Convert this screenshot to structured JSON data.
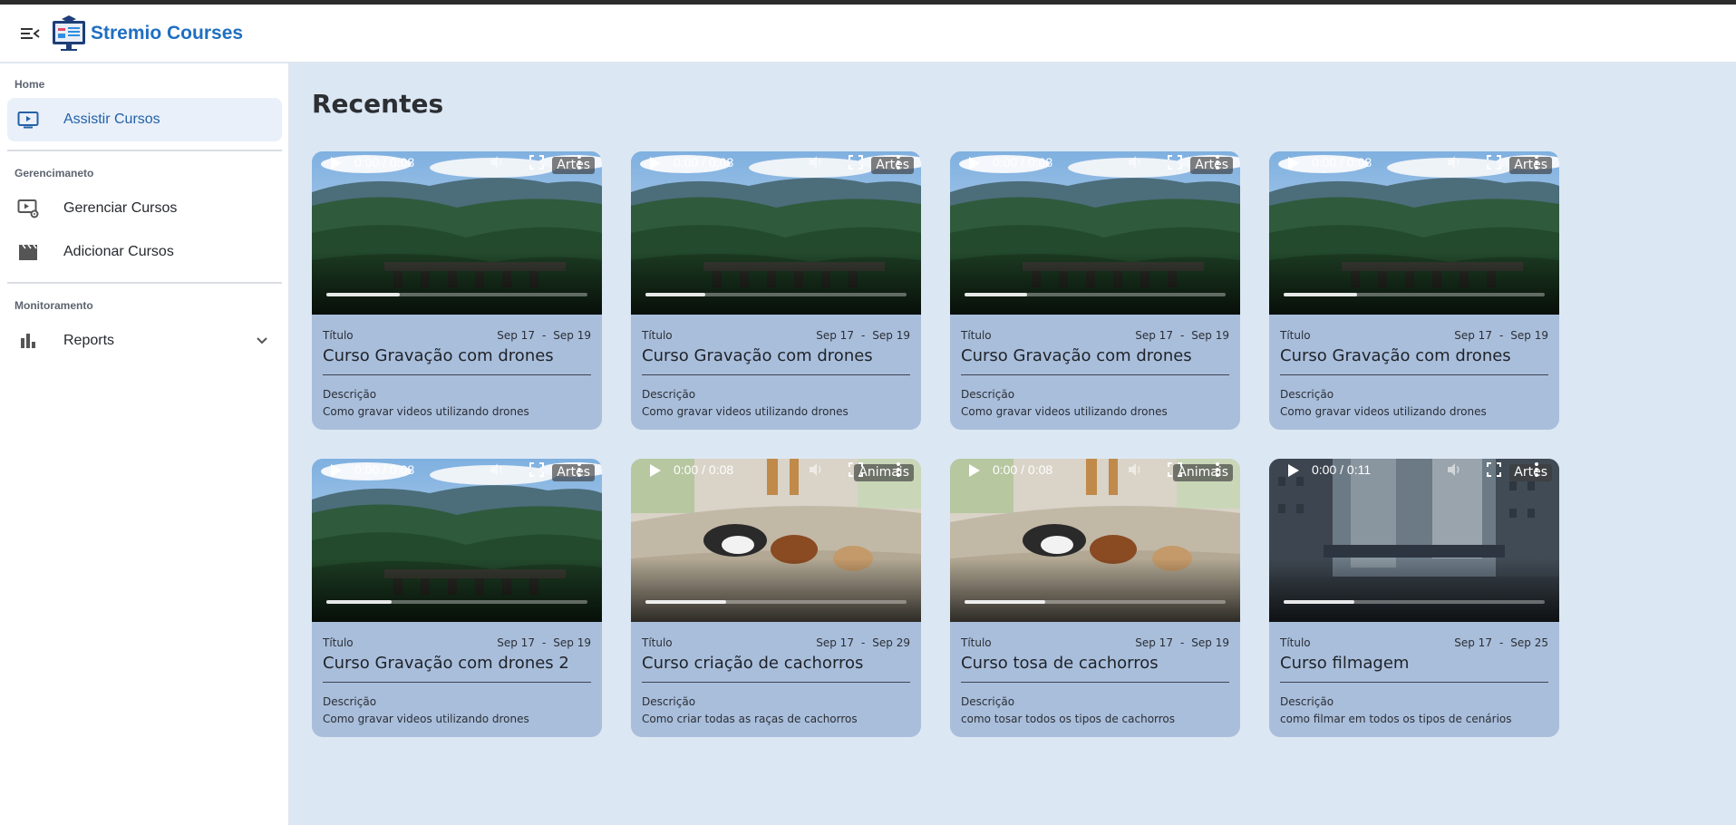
{
  "app": {
    "brand": "Stremio Courses"
  },
  "sidebar": {
    "sections": [
      {
        "label": "Home",
        "items": [
          {
            "label": "Assistir Cursos",
            "icon": "tv-play-icon",
            "active": true
          }
        ]
      },
      {
        "label": "Gerencimaneto",
        "items": [
          {
            "label": "Gerenciar Cursos",
            "icon": "video-settings-icon",
            "active": false
          },
          {
            "label": "Adicionar Cursos",
            "icon": "clapperboard-icon",
            "active": false
          }
        ]
      },
      {
        "label": "Monitoramento",
        "items": [
          {
            "label": "Reports",
            "icon": "bar-chart-icon",
            "active": false,
            "expandable": true
          }
        ]
      }
    ]
  },
  "main": {
    "title": "Recentes"
  },
  "labels": {
    "titulo": "Título",
    "descricao": "Descrição",
    "date_sep": "-"
  },
  "courses": [
    {
      "category": "Artes",
      "time": "0:00 / 0:08",
      "progress": 0.28,
      "start": "Sep 17",
      "end": "Sep 19",
      "title": "Curso Gravação com drones",
      "description": "Como gravar videos utilizando drones",
      "scene": "forest"
    },
    {
      "category": "Artes",
      "time": "0:00 / 0:08",
      "progress": 0.23,
      "start": "Sep 17",
      "end": "Sep 19",
      "title": "Curso Gravação com drones",
      "description": "Como gravar videos utilizando drones",
      "scene": "forest"
    },
    {
      "category": "Artes",
      "time": "0:00 / 0:08",
      "progress": 0.24,
      "start": "Sep 17",
      "end": "Sep 19",
      "title": "Curso Gravação com drones",
      "description": "Como gravar videos utilizando drones",
      "scene": "forest"
    },
    {
      "category": "Artes",
      "time": "0:00 / 0:08",
      "progress": 0.28,
      "start": "Sep 17",
      "end": "Sep 19",
      "title": "Curso Gravação com drones",
      "description": "Como gravar videos utilizando drones",
      "scene": "forest"
    },
    {
      "category": "Artes",
      "time": "0:00 / 0:08",
      "progress": 0.25,
      "start": "Sep 17",
      "end": "Sep 19",
      "title": "Curso Gravação com drones 2",
      "description": "Como gravar videos utilizando drones",
      "scene": "forest"
    },
    {
      "category": "Animais",
      "time": "0:00 / 0:08",
      "progress": 0.31,
      "start": "Sep 17",
      "end": "Sep 29",
      "title": "Curso criação de cachorros",
      "description": "Como criar todas as raças de cachorros",
      "scene": "dogs"
    },
    {
      "category": "Animais",
      "time": "0:00 / 0:08",
      "progress": 0.31,
      "start": "Sep 17",
      "end": "Sep 19",
      "title": "Curso tosa de cachorros",
      "description": "como tosar todos os tipos de cachorros",
      "scene": "dogs"
    },
    {
      "category": "Artes",
      "time": "0:00 / 0:11",
      "progress": 0.27,
      "start": "Sep 17",
      "end": "Sep 25",
      "title": "Curso filmagem",
      "description": "como filmar em todos os tipos de cenários",
      "scene": "city"
    }
  ]
}
